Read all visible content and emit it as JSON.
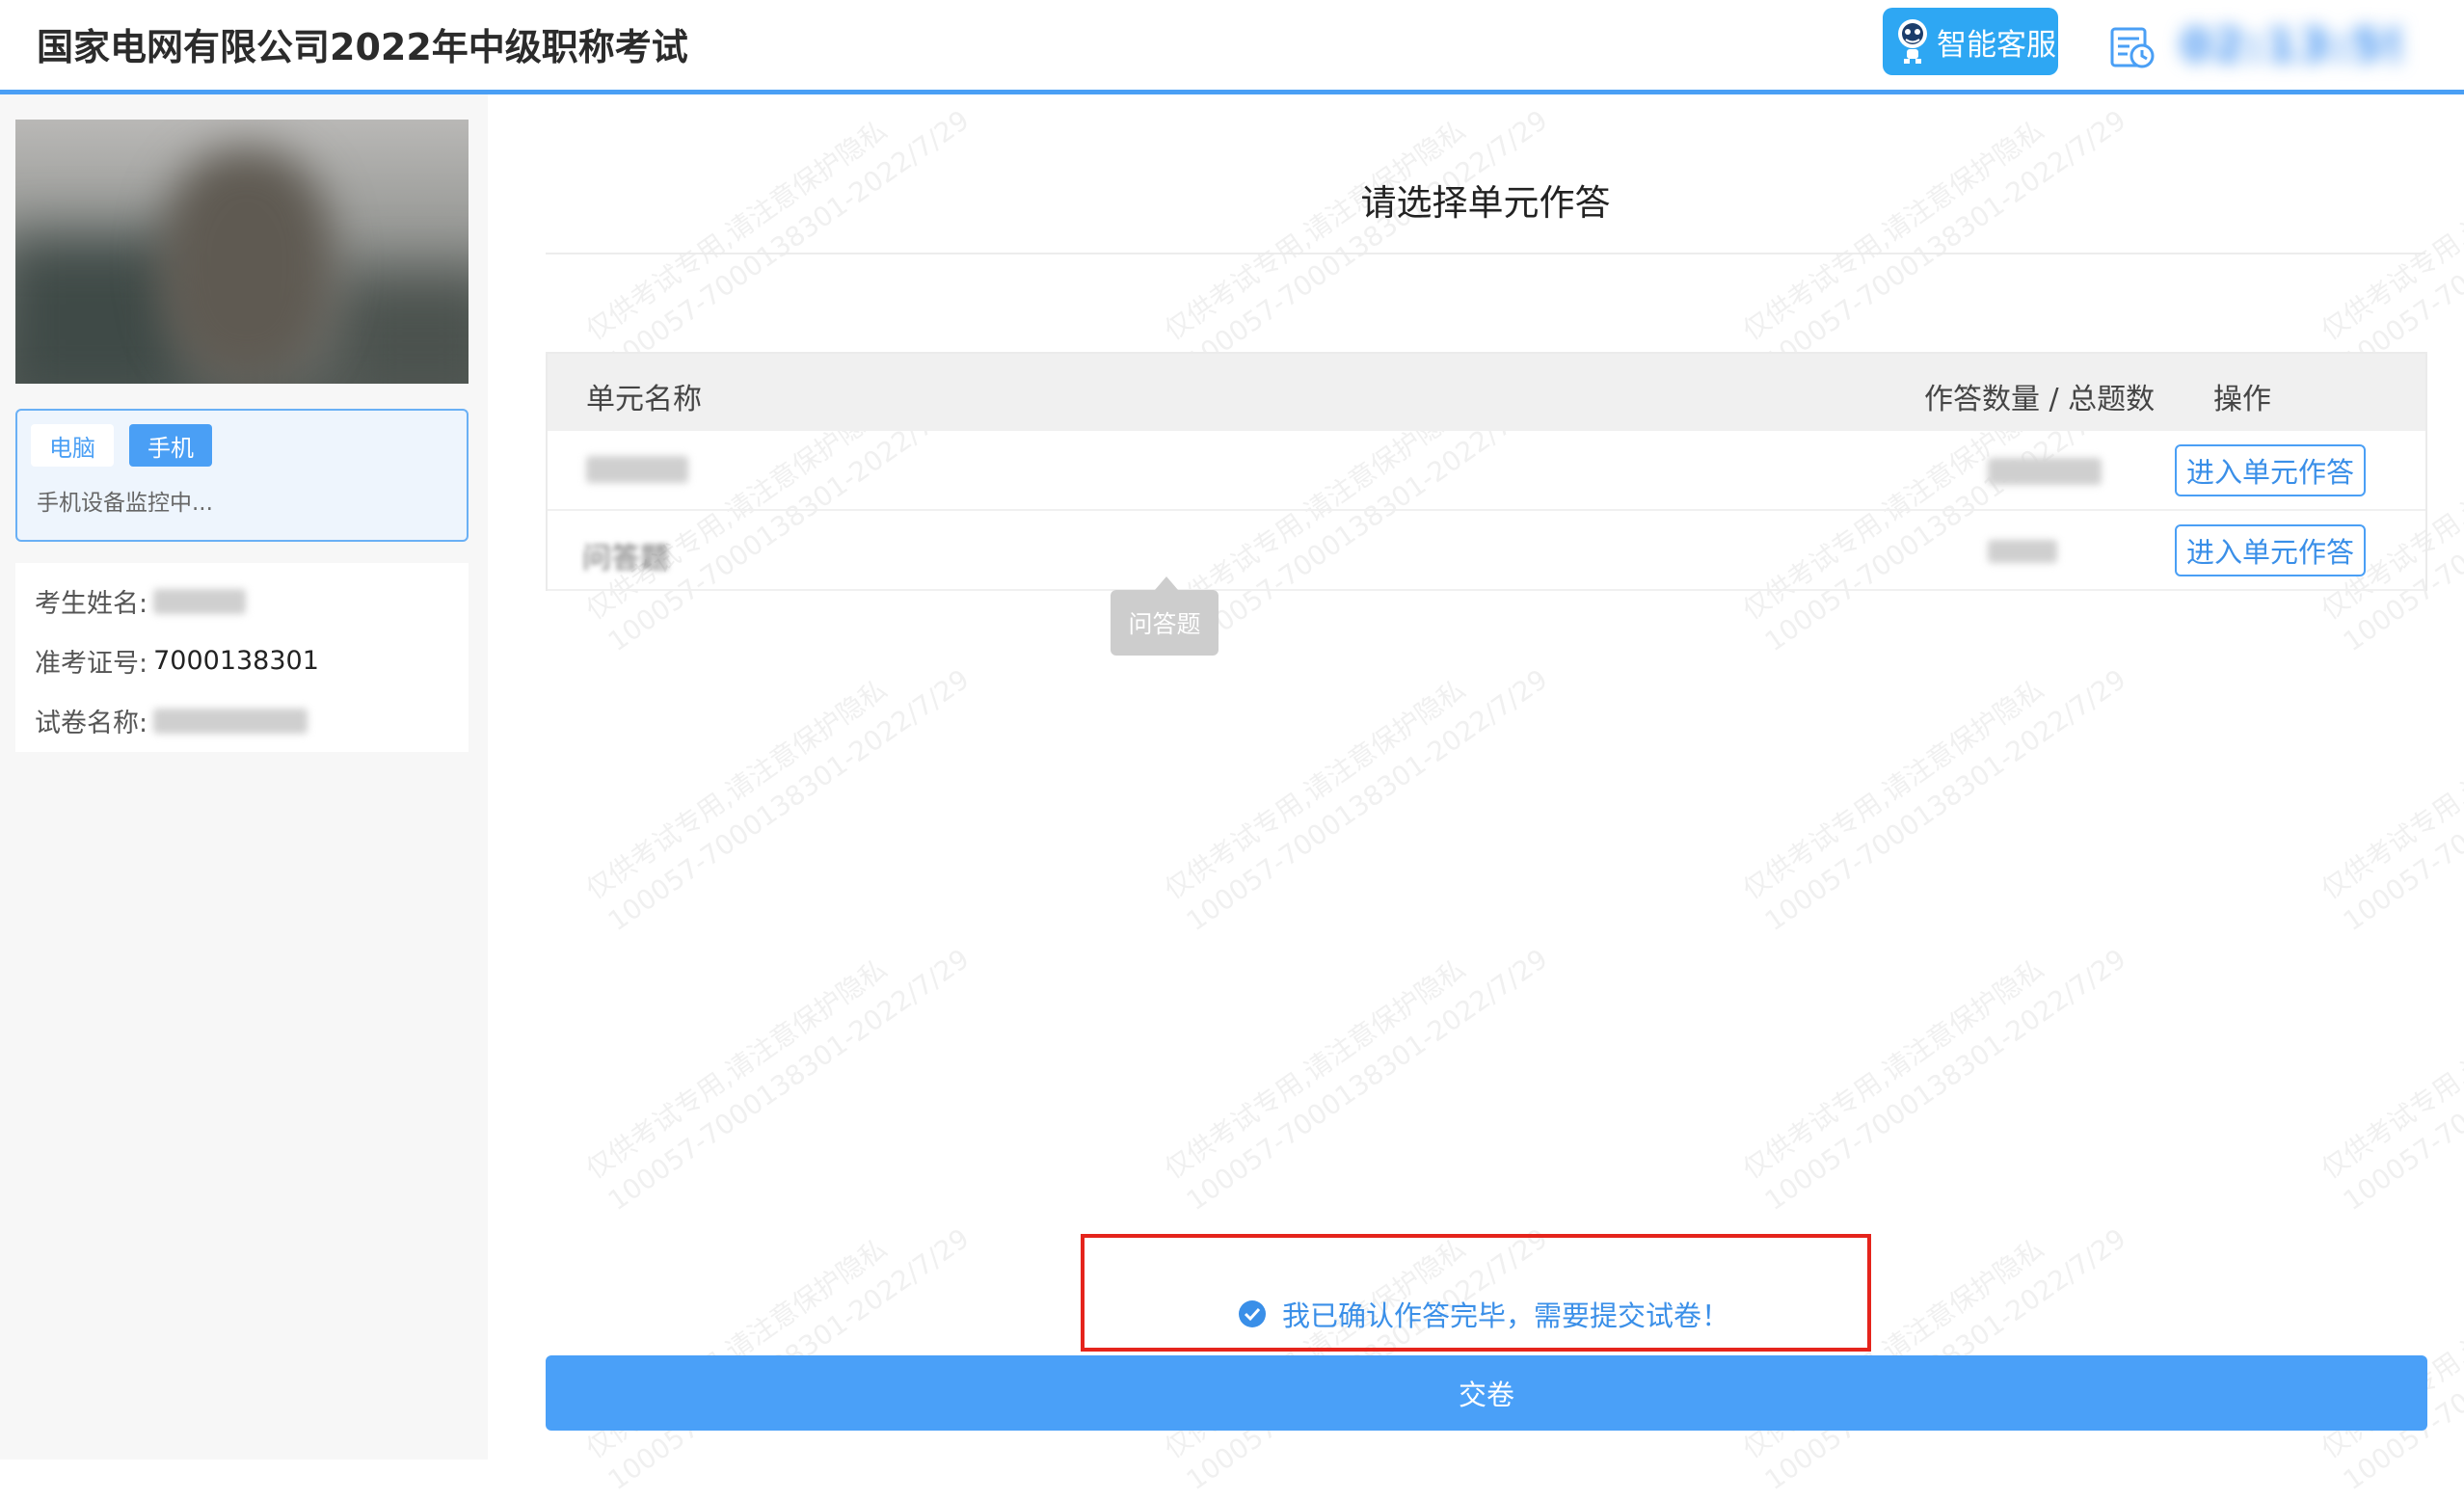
{
  "header": {
    "app_title": "国家电网有限公司2022年中级职称考试",
    "service_label": "智能客服",
    "timer_value": "02:13:59",
    "icons": {
      "service": "robot-icon",
      "timer": "calendar-clock-icon"
    }
  },
  "sidebar": {
    "device_tabs": [
      "电脑",
      "手机"
    ],
    "active_device": "手机",
    "monitor_status": "手机设备监控中...",
    "info": {
      "name_label": "考生姓名:",
      "id_label": "准考证号:",
      "id_value": "7000138301",
      "paper_label": "试卷名称:"
    }
  },
  "main": {
    "title": "请选择单元作答",
    "table": {
      "headers": [
        "单元名称",
        "作答数量 / 总题数",
        "操作"
      ],
      "rows": [
        {
          "name": "",
          "count": "",
          "action": "进入单元作答"
        },
        {
          "name": "问答题",
          "count": "",
          "action": "进入单元作答"
        }
      ]
    },
    "tooltip": "问答题",
    "confirm_text": "我已确认作答完毕，需要提交试卷！",
    "submit_label": "交卷",
    "watermark": [
      "仅供考试专用,请注意保护隐私",
      "100057-7000138301-2022/7/29"
    ]
  },
  "colors": {
    "accent": "#4a9ff5",
    "service_button": "#2ea7f3",
    "highlight_border": "#e5241c"
  }
}
